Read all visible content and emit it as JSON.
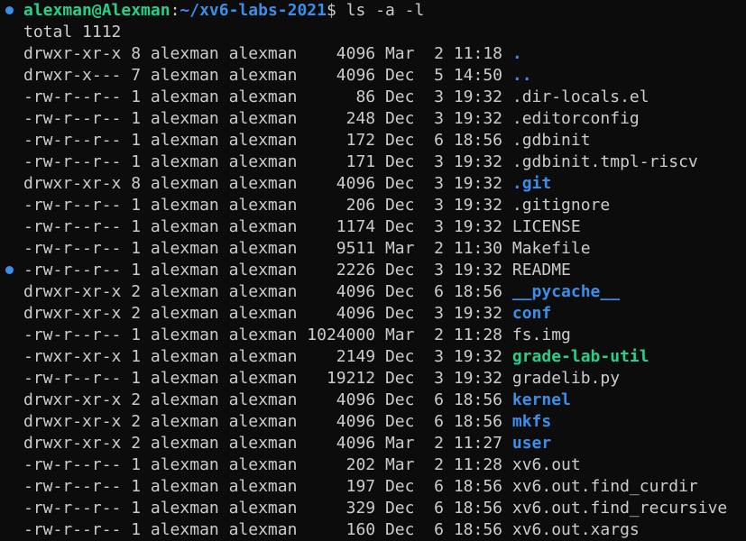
{
  "terminal": {
    "prompt": {
      "user_host": "alexman@Alexman",
      "colon": ":",
      "path": "~/xv6-labs-2021",
      "symbol": "$ ",
      "command": "ls -a -l"
    },
    "total": "total 1112",
    "entries": [
      {
        "meta": "drwxr-xr-x 8 alexman alexman    4096 Mar  2 11:18 ",
        "name": ".",
        "kind": "dir"
      },
      {
        "meta": "drwxr-x--- 7 alexman alexman    4096 Dec  5 14:50 ",
        "name": "..",
        "kind": "dir"
      },
      {
        "meta": "-rw-r--r-- 1 alexman alexman      86 Dec  3 19:32 ",
        "name": ".dir-locals.el",
        "kind": "file"
      },
      {
        "meta": "-rw-r--r-- 1 alexman alexman     248 Dec  3 19:32 ",
        "name": ".editorconfig",
        "kind": "file"
      },
      {
        "meta": "-rw-r--r-- 1 alexman alexman     172 Dec  6 18:56 ",
        "name": ".gdbinit",
        "kind": "file"
      },
      {
        "meta": "-rw-r--r-- 1 alexman alexman     171 Dec  3 19:32 ",
        "name": ".gdbinit.tmpl-riscv",
        "kind": "file"
      },
      {
        "meta": "drwxr-xr-x 8 alexman alexman    4096 Dec  3 19:32 ",
        "name": ".git",
        "kind": "dir"
      },
      {
        "meta": "-rw-r--r-- 1 alexman alexman     206 Dec  3 19:32 ",
        "name": ".gitignore",
        "kind": "file"
      },
      {
        "meta": "-rw-r--r-- 1 alexman alexman    1174 Dec  3 19:32 ",
        "name": "LICENSE",
        "kind": "file"
      },
      {
        "meta": "-rw-r--r-- 1 alexman alexman    9511 Mar  2 11:30 ",
        "name": "Makefile",
        "kind": "file"
      },
      {
        "meta": "-rw-r--r-- 1 alexman alexman    2226 Dec  3 19:32 ",
        "name": "README",
        "kind": "file"
      },
      {
        "meta": "drwxr-xr-x 2 alexman alexman    4096 Dec  6 18:56 ",
        "name": "__pycache__",
        "kind": "dir"
      },
      {
        "meta": "drwxr-xr-x 2 alexman alexman    4096 Dec  3 19:32 ",
        "name": "conf",
        "kind": "dir"
      },
      {
        "meta": "-rw-r--r-- 1 alexman alexman 1024000 Mar  2 11:28 ",
        "name": "fs.img",
        "kind": "file"
      },
      {
        "meta": "-rwxr-xr-x 1 alexman alexman    2149 Dec  3 19:32 ",
        "name": "grade-lab-util",
        "kind": "exec"
      },
      {
        "meta": "-rw-r--r-- 1 alexman alexman   19212 Dec  3 19:32 ",
        "name": "gradelib.py",
        "kind": "file"
      },
      {
        "meta": "drwxr-xr-x 2 alexman alexman    4096 Dec  6 18:56 ",
        "name": "kernel",
        "kind": "dir"
      },
      {
        "meta": "drwxr-xr-x 2 alexman alexman    4096 Dec  6 18:56 ",
        "name": "mkfs",
        "kind": "dir"
      },
      {
        "meta": "drwxr-xr-x 2 alexman alexman    4096 Mar  2 11:27 ",
        "name": "user",
        "kind": "dir"
      },
      {
        "meta": "-rw-r--r-- 1 alexman alexman     202 Mar  2 11:28 ",
        "name": "xv6.out",
        "kind": "file"
      },
      {
        "meta": "-rw-r--r-- 1 alexman alexman     197 Dec  6 18:56 ",
        "name": "xv6.out.find_curdir",
        "kind": "file"
      },
      {
        "meta": "-rw-r--r-- 1 alexman alexman     329 Dec  6 18:56 ",
        "name": "xv6.out.find_recursive",
        "kind": "file"
      },
      {
        "meta": "-rw-r--r-- 1 alexman alexman     160 Dec  6 18:56 ",
        "name": "xv6.out.xargs",
        "kind": "file"
      }
    ],
    "colors": {
      "background": "#0c0c0c",
      "foreground": "#cccccc",
      "directory": "#3b8eea",
      "executable": "#23d18b",
      "prompt_user": "#23d18b",
      "marker": "#3b8eea"
    }
  }
}
